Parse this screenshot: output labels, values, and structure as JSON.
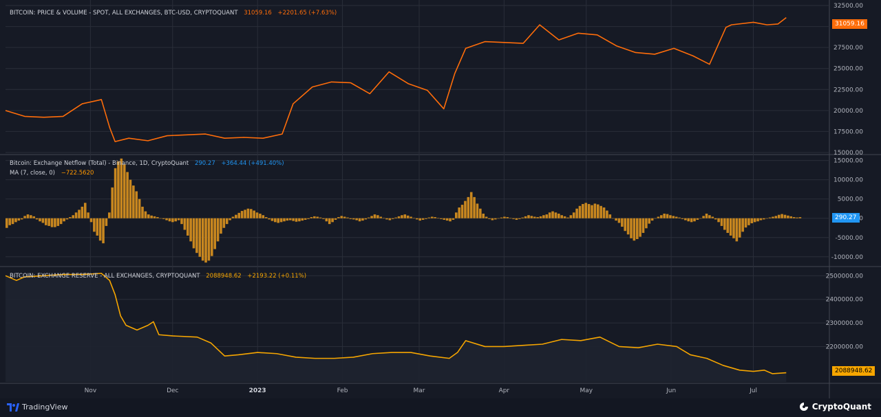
{
  "colors": {
    "price": "#ff6d0a",
    "netflow_bar": "#c8871f",
    "netflow_badge": "#2196f3",
    "reserve": "#f7a600",
    "grid": "#2a2e39",
    "panel_border": "#434651"
  },
  "panels": {
    "price": {
      "title": "BITCOIN: PRICE & VOLUME - SPOT, ALL EXCHANGES, BTC-USD, CRYPTOQUANT",
      "last": "31059.16",
      "change": "+2201.65 (+7.63%)",
      "badge": "31059.16"
    },
    "netflow": {
      "title": "Bitcoin: Exchange Netflow (Total) - Binance, 1D, CryptoQuant",
      "last": "290.27",
      "change": "+364.44 (+491.40%)",
      "ma_label": "MA (7, close, 0)",
      "ma_value": "−722.5620",
      "badge": "290.27"
    },
    "reserve": {
      "title": "BITCOIN: EXCHANGE RESERVE - ALL EXCHANGES, CRYPTOQUANT",
      "last": "2088948.62",
      "change": "+2193.22 (+0.11%)",
      "badge": "2088948.62"
    }
  },
  "footer": {
    "left_brand": "TradingView",
    "right_brand": "CryptoQuant",
    "left_icon": "tradingview-logo-icon",
    "right_icon": "cryptoquant-logo-icon"
  },
  "chart_data": [
    {
      "type": "line",
      "ylim": [
        15000,
        32500
      ],
      "y_ticks": [
        "15000.00",
        "17500.00",
        "20000.00",
        "22500.00",
        "25000.00",
        "27500.00",
        "30000.00",
        "32500.00"
      ],
      "x_labels": [
        "Nov",
        "Dec",
        "2023",
        "Feb",
        "Mar",
        "Apr",
        "May",
        "Jun",
        "Jul"
      ],
      "x": [
        "Oct 01",
        "Oct 08",
        "Oct 15",
        "Oct 22",
        "Oct 29",
        "Nov 05",
        "Nov 08",
        "Nov 10",
        "Nov 15",
        "Nov 22",
        "Nov 29",
        "Dec 06",
        "Dec 13",
        "Dec 20",
        "Dec 27",
        "Jan 03",
        "Jan 10",
        "Jan 14",
        "Jan 21",
        "Jan 28",
        "Feb 04",
        "Feb 11",
        "Feb 18",
        "Feb 25",
        "Mar 04",
        "Mar 10",
        "Mar 14",
        "Mar 18",
        "Mar 25",
        "Apr 01",
        "Apr 08",
        "Apr 14",
        "Apr 21",
        "Apr 28",
        "May 05",
        "May 12",
        "May 19",
        "May 26",
        "Jun 02",
        "Jun 09",
        "Jun 15",
        "Jun 21",
        "Jun 23",
        "Jul 01",
        "Jul 06",
        "Jul 10",
        "Jul 13"
      ],
      "values": [
        20000,
        19300,
        19200,
        19300,
        20800,
        21300,
        18000,
        16300,
        16700,
        16400,
        17000,
        17100,
        17200,
        16700,
        16800,
        16700,
        17200,
        20800,
        22800,
        23400,
        23300,
        22000,
        24600,
        23200,
        22400,
        20200,
        24400,
        27400,
        28200,
        28100,
        28000,
        30200,
        28400,
        29200,
        29000,
        27700,
        26900,
        26700,
        27400,
        26500,
        25500,
        29900,
        30200,
        30500,
        30200,
        30300,
        31059
      ]
    },
    {
      "type": "bar",
      "ylim": [
        -12000,
        16000
      ],
      "y_ticks": [
        "-10000.00",
        "-5000.00",
        "0.00",
        "5000.00",
        "10000.00",
        "15000.00"
      ],
      "x_labels": [
        "Nov",
        "Dec",
        "2023",
        "Feb",
        "Mar",
        "Apr",
        "May",
        "Jun",
        "Jul"
      ],
      "values": [
        -2500,
        -1800,
        -1500,
        -1000,
        -600,
        -300,
        600,
        1000,
        800,
        500,
        -300,
        -800,
        -1200,
        -1800,
        -2000,
        -2300,
        -2300,
        -2000,
        -1500,
        -800,
        -300,
        300,
        800,
        1500,
        2200,
        3000,
        4000,
        1500,
        -1000,
        -3500,
        -4500,
        -5800,
        -6500,
        -2000,
        1500,
        8000,
        13000,
        14800,
        15500,
        14000,
        12000,
        10000,
        8500,
        7000,
        5000,
        3000,
        1800,
        1000,
        700,
        500,
        300,
        0,
        -200,
        -500,
        -800,
        -1000,
        -800,
        -500,
        -1500,
        -3000,
        -4500,
        -6000,
        -7800,
        -9000,
        -10000,
        -11000,
        -11500,
        -11000,
        -9800,
        -8000,
        -6000,
        -4000,
        -2500,
        -1500,
        -500,
        400,
        900,
        1400,
        1900,
        2200,
        2500,
        2400,
        2000,
        1500,
        1200,
        800,
        300,
        -300,
        -700,
        -1000,
        -1200,
        -1000,
        -800,
        -600,
        -500,
        -700,
        -900,
        -800,
        -600,
        -400,
        -200,
        300,
        500,
        400,
        200,
        -200,
        -800,
        -1500,
        -1000,
        -400,
        300,
        600,
        400,
        200,
        -200,
        -300,
        -500,
        -800,
        -600,
        -300,
        200,
        600,
        1000,
        800,
        400,
        100,
        -300,
        -500,
        -200,
        200,
        500,
        800,
        1000,
        700,
        400,
        100,
        -300,
        -600,
        -400,
        -200,
        200,
        400,
        300,
        100,
        -200,
        -400,
        -600,
        -800,
        -400,
        1500,
        2800,
        3500,
        4500,
        5500,
        6800,
        5500,
        3800,
        2500,
        1200,
        400,
        -200,
        -500,
        -300,
        -100,
        200,
        400,
        300,
        100,
        -200,
        -400,
        -200,
        200,
        500,
        800,
        600,
        400,
        300,
        500,
        800,
        1000,
        1500,
        1800,
        1500,
        1200,
        800,
        500,
        200,
        800,
        1500,
        2500,
        3200,
        3700,
        4000,
        3700,
        3400,
        3800,
        3600,
        3200,
        2800,
        2000,
        1000,
        0,
        -600,
        -1200,
        -2200,
        -3300,
        -4200,
        -5200,
        -5800,
        -5400,
        -4800,
        -3800,
        -2600,
        -1400,
        -600,
        0,
        400,
        800,
        1200,
        1100,
        800,
        600,
        400,
        200,
        -200,
        -500,
        -800,
        -1000,
        -800,
        -400,
        0,
        600,
        1200,
        800,
        400,
        -300,
        -1000,
        -2000,
        -3000,
        -3800,
        -4500,
        -5200,
        -6000,
        -5000,
        -3500,
        -2400,
        -1800,
        -1300,
        -1000,
        -800,
        -500,
        -300,
        -100,
        200,
        400,
        600,
        900,
        1100,
        900,
        700,
        500,
        300,
        200,
        290
      ]
    },
    {
      "type": "area",
      "ylim": [
        2050000,
        2530000
      ],
      "y_ticks": [
        "2200000.00",
        "2300000.00",
        "2400000.00",
        "2500000.00"
      ],
      "x_labels": [
        "Nov",
        "Dec",
        "2023",
        "Feb",
        "Mar",
        "Apr",
        "May",
        "Jun",
        "Jul"
      ],
      "x": [
        "Oct 01",
        "Oct 05",
        "Oct 08",
        "Oct 15",
        "Oct 22",
        "Oct 29",
        "Nov 05",
        "Nov 08",
        "Nov 10",
        "Nov 12",
        "Nov 14",
        "Nov 18",
        "Nov 22",
        "Nov 24",
        "Nov 26",
        "Dec 01",
        "Dec 10",
        "Dec 15",
        "Dec 20",
        "Dec 25",
        "Jan 01",
        "Jan 08",
        "Jan 15",
        "Jan 22",
        "Jan 29",
        "Feb 05",
        "Feb 12",
        "Feb 19",
        "Feb 26",
        "Mar 05",
        "Mar 12",
        "Mar 15",
        "Mar 18",
        "Mar 25",
        "Apr 01",
        "Apr 08",
        "Apr 15",
        "Apr 22",
        "Apr 29",
        "May 06",
        "May 13",
        "May 20",
        "May 27",
        "Jun 03",
        "Jun 08",
        "Jun 14",
        "Jun 20",
        "Jun 26",
        "Jul 01",
        "Jul 05",
        "Jul 08",
        "Jul 13"
      ],
      "values": [
        2500000,
        2480000,
        2495000,
        2500000,
        2505000,
        2505000,
        2510000,
        2480000,
        2420000,
        2330000,
        2290000,
        2270000,
        2290000,
        2305000,
        2250000,
        2245000,
        2240000,
        2215000,
        2160000,
        2165000,
        2175000,
        2170000,
        2155000,
        2150000,
        2150000,
        2155000,
        2170000,
        2175000,
        2175000,
        2160000,
        2150000,
        2175000,
        2225000,
        2200000,
        2200000,
        2205000,
        2210000,
        2230000,
        2225000,
        2240000,
        2200000,
        2195000,
        2210000,
        2200000,
        2165000,
        2150000,
        2120000,
        2100000,
        2095000,
        2100000,
        2085000,
        2089000
      ]
    }
  ]
}
